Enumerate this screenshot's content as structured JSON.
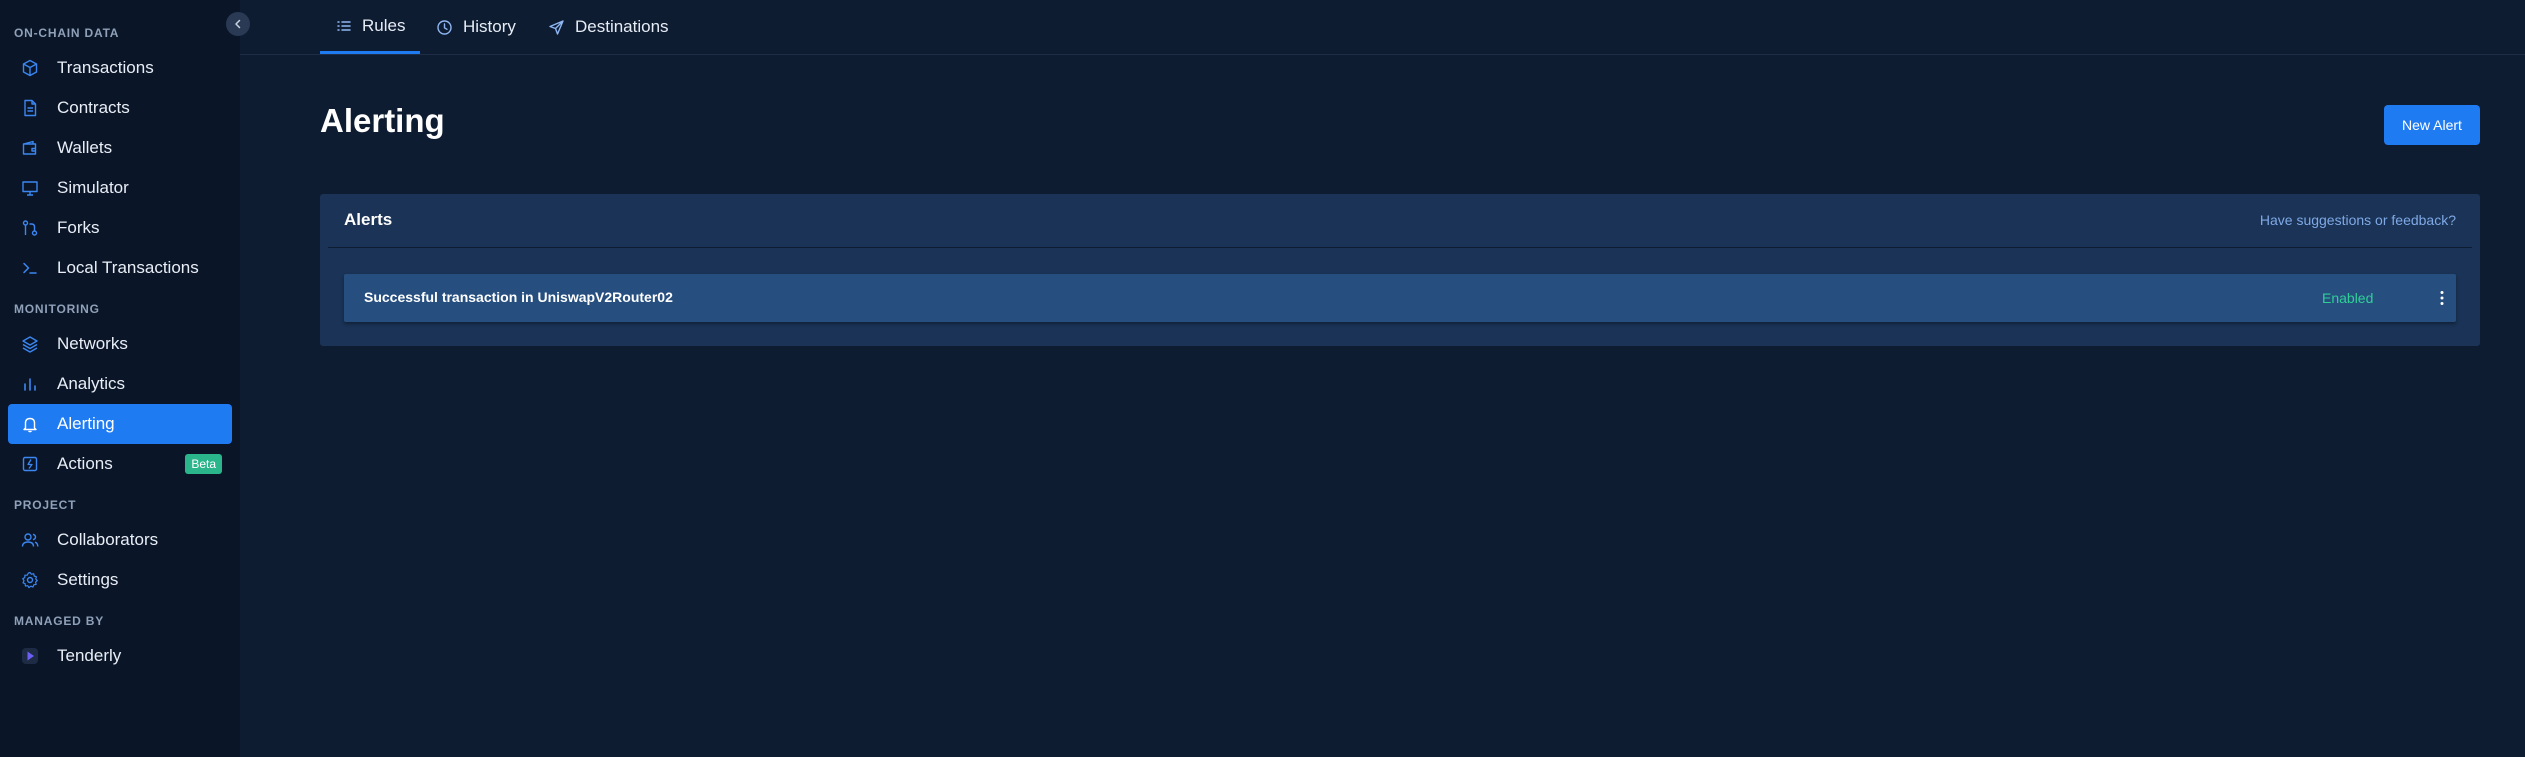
{
  "sidebar": {
    "sections": {
      "on_chain": "ON-CHAIN DATA",
      "monitoring": "MONITORING",
      "project": "PROJECT",
      "managed_by": "MANAGED BY"
    },
    "items": [
      {
        "label": "Transactions",
        "icon": "cube-icon"
      },
      {
        "label": "Contracts",
        "icon": "document-icon"
      },
      {
        "label": "Wallets",
        "icon": "wallet-icon"
      },
      {
        "label": "Simulator",
        "icon": "monitor-icon"
      },
      {
        "label": "Forks",
        "icon": "fork-icon"
      },
      {
        "label": "Local Transactions",
        "icon": "terminal-icon"
      },
      {
        "label": "Networks",
        "icon": "layers-icon"
      },
      {
        "label": "Analytics",
        "icon": "bar-chart-icon"
      },
      {
        "label": "Alerting",
        "icon": "bell-icon"
      },
      {
        "label": "Actions",
        "icon": "lightning-icon",
        "badge": "Beta"
      },
      {
        "label": "Collaborators",
        "icon": "users-icon"
      },
      {
        "label": "Settings",
        "icon": "gear-icon"
      },
      {
        "label": "Tenderly",
        "icon": "tenderly-logo"
      }
    ],
    "active_item": "Alerting"
  },
  "tabs": [
    {
      "label": "Rules",
      "icon": "list-icon"
    },
    {
      "label": "History",
      "icon": "clock-icon"
    },
    {
      "label": "Destinations",
      "icon": "send-icon"
    }
  ],
  "active_tab": "Rules",
  "page": {
    "title": "Alerting",
    "new_alert_label": "New Alert"
  },
  "alerts": {
    "title": "Alerts",
    "feedback_link": "Have suggestions or feedback?",
    "rows": [
      {
        "name": "Successful transaction in UniswapV2Router02",
        "status": "Enabled"
      }
    ]
  },
  "colors": {
    "accent": "#1f7bf2",
    "enabled": "#2fcf96",
    "beta": "#2bb58a",
    "sidebar_bg": "#0a1628",
    "main_bg": "#0e1c31"
  }
}
